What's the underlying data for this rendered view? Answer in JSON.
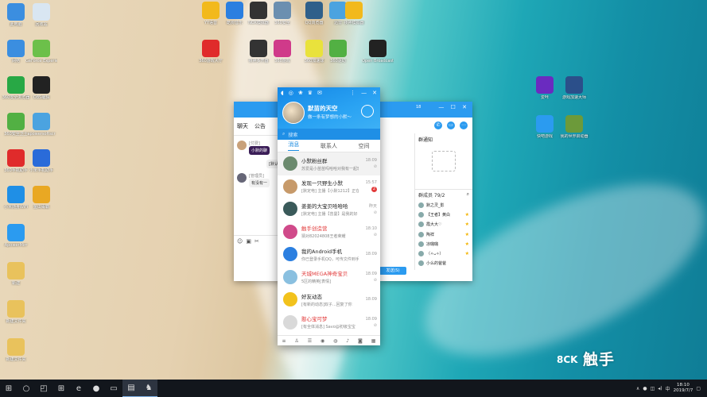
{
  "desktop_icons": [
    {
      "label": "此电脑",
      "color": "#3b8ee0"
    },
    {
      "label": "回收站",
      "color": "#d9e6f2"
    },
    {
      "label": "网络",
      "color": "#3b8ee0"
    },
    {
      "label": "GeForce Experience",
      "color": "#6cc04a"
    },
    {
      "label": "360安全浏览器",
      "color": "#28a845"
    },
    {
      "label": "OBS编辑",
      "color": "#222222"
    },
    {
      "label": "360安全卫士",
      "color": "#52b043"
    },
    {
      "label": "apowersoftscr",
      "color": "#4ba3e0"
    },
    {
      "label": "360手机助手",
      "color": "#e02b2b"
    },
    {
      "label": "小米手机助手",
      "color": "#2a6bd9"
    },
    {
      "label": "小米随身WiFi",
      "color": "#1f8fe6"
    },
    {
      "label": "金山毒霸",
      "color": "#e9a823"
    },
    {
      "label": "ApowerMirr",
      "color": "#2b9bf0"
    },
    {
      "label": "新建",
      "color": "#e9c25c"
    },
    {
      "label": "新建文件夹",
      "color": "#e9c25c"
    },
    {
      "label": "新建文件夹",
      "color": "#e9c25c"
    }
  ],
  "top_icons": [
    {
      "label": "YY语音",
      "color": "#f2b91c"
    },
    {
      "label": "酷狗音乐",
      "color": "#2b7fe0"
    },
    {
      "label": "NOX模拟器",
      "color": "#333333"
    },
    {
      "label": "360安全",
      "color": "#6b8fb0"
    },
    {
      "label": "QQ浏览器",
      "color": "#2f5f8a"
    },
    {
      "label": "迅雷",
      "color": "#4ba3e0"
    },
    {
      "label": "夜神模拟器",
      "color": "#f2b91c"
    },
    {
      "label": "360游戏大厅",
      "color": "#e02b2b"
    },
    {
      "label": "夜神多开器",
      "color": "#333333"
    },
    {
      "label": "360游戏",
      "color": "#d03a8a"
    },
    {
      "label": "360加速球",
      "color": "#e9e23c"
    },
    {
      "label": "360驱动",
      "color": "#52b043"
    },
    {
      "label": "Open Broadcaster",
      "color": "#222222"
    }
  ],
  "right_icons": [
    {
      "label": "爱咔",
      "color": "#6a2bc0"
    },
    {
      "label": "游戏加速大师",
      "color": "#2b4f8a"
    },
    {
      "label": "快吧游戏",
      "color": "#2b9bf0"
    },
    {
      "label": "我的世界启动器",
      "color": "#6c9a3a"
    }
  ],
  "chat_left": {
    "tabs": [
      "聊天",
      "公告"
    ],
    "msg1_tag": "[付费]",
    "msg1_bubble": "小默的聊",
    "msg2_bubble": "[默认]",
    "msg3_tag": "[管理员]",
    "msg3_bubble": "有没有一"
  },
  "chat_right": {
    "header_number": "18",
    "notice_title": "群通知",
    "members_title": "群成员 79/2",
    "send_label": "发送(S)",
    "members": [
      {
        "name": "默之灵_影",
        "star": false
      },
      {
        "name": "【王者】黄白",
        "star": true
      },
      {
        "name": "霞大大♡",
        "star": true
      },
      {
        "name": "陶祥",
        "star": true
      },
      {
        "name": "凉璐璐",
        "star": true
      },
      {
        "name": "（✧ᴗ✧）",
        "star": true
      },
      {
        "name": "小么的爸爸",
        "star": false
      }
    ]
  },
  "qq": {
    "nickname": "默苗的天空",
    "signature": "做一条有梦想的小默～",
    "search_placeholder": "搜索",
    "tabs": [
      "消息",
      "联系人",
      "空间"
    ],
    "conversations": [
      {
        "title": "小默粉丝群",
        "preview": "苏爱是小苗苗吗哈哈对我有一起玩的",
        "time": "18:09",
        "avatar": "#6b8a6e",
        "red": false,
        "badge": "",
        "mute": "⊘",
        "active": true
      },
      {
        "title": "发现一只野生小默",
        "preview": "[默定电] 主播【小默1212】正在直播",
        "time": "15:57",
        "avatar": "#c79a6a",
        "red": false,
        "badge": "2",
        "mute": "",
        "active": false
      },
      {
        "title": "姜姜的大宝贝哈哈哈",
        "preview": "[默定电] 主播【曾曼】是我的好",
        "time": "昨天",
        "avatar": "#3a5a5a",
        "red": false,
        "badge": "",
        "mute": "⊘",
        "active": false
      },
      {
        "title": "触手创造营",
        "preview": "猜对82024808王者荣耀",
        "time": "18:10",
        "avatar": "#d04a8a",
        "red": true,
        "badge": "",
        "mute": "⊘",
        "active": false
      },
      {
        "title": "我的Android手机",
        "preview": "你已登录手机QQ，可传文件到手机",
        "time": "18:09",
        "avatar": "#2b7fe0",
        "red": false,
        "badge": "",
        "mute": "",
        "active": false
      },
      {
        "title": "天城MEGA神奇宝贝",
        "preview": "5区的精英[表情]",
        "time": "18:09",
        "avatar": "#8ac0e0",
        "red": true,
        "badge": "",
        "mute": "⊘",
        "active": false
      },
      {
        "title": "好友动态",
        "preview": "[有新的动态]双子...回复了你",
        "time": "18:09",
        "avatar": "#f2c21c",
        "red": false,
        "badge": "",
        "mute": "",
        "active": false
      },
      {
        "title": "憨心宝可梦",
        "preview": "[有全体消息] Savo@初级宝宝",
        "time": "18:09",
        "avatar": "#d9d9d9",
        "red": true,
        "badge": "",
        "mute": "⊘",
        "active": false
      }
    ]
  },
  "watermark": {
    "brand": "触手",
    "sub": "8CK"
  },
  "taskbar": {
    "time": "18:10",
    "date": "2019/7/7",
    "apps": [
      "◰",
      "⊞",
      "e",
      "●",
      "▭",
      "▤",
      "♞"
    ]
  }
}
